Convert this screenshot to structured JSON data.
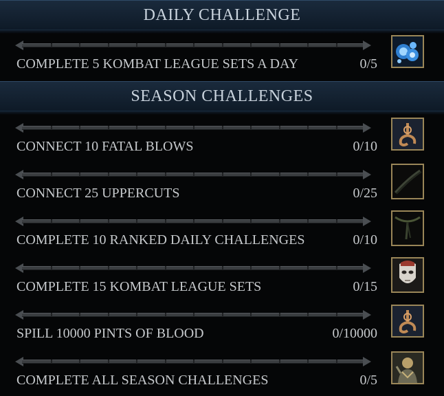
{
  "daily": {
    "title": "DAILY CHALLENGE",
    "items": [
      {
        "label": "COMPLETE 5 KOMBAT LEAGUE SETS A DAY",
        "count": "0/5",
        "progress": 0,
        "reward_icon": "soul-fragments-icon"
      }
    ]
  },
  "season": {
    "title": "SEASON CHALLENGES",
    "items": [
      {
        "label": "CONNECT 10 FATAL BLOWS",
        "count": "0/10",
        "progress": 0,
        "reward_icon": "hook-emblem-icon"
      },
      {
        "label": "CONNECT 25 UPPERCUTS",
        "count": "0/25",
        "progress": 0,
        "reward_icon": "sash-gear-icon"
      },
      {
        "label": "COMPLETE 10 RANKED DAILY CHALLENGES",
        "count": "0/10",
        "progress": 0,
        "reward_icon": "belt-gear-icon"
      },
      {
        "label": "COMPLETE 15 KOMBAT LEAGUE SETS",
        "count": "0/15",
        "progress": 0,
        "reward_icon": "mask-gear-icon"
      },
      {
        "label": "SPILL 10000 PINTS OF BLOOD",
        "count": "0/10000",
        "progress": 0,
        "reward_icon": "hook-emblem-icon"
      },
      {
        "label": "COMPLETE ALL SEASON CHALLENGES",
        "count": "0/5",
        "progress": 0,
        "reward_icon": "character-skin-icon"
      }
    ]
  },
  "colors": {
    "accent": "#9a8658",
    "header": "#1a2a3c",
    "text": "#c6c9cc"
  }
}
